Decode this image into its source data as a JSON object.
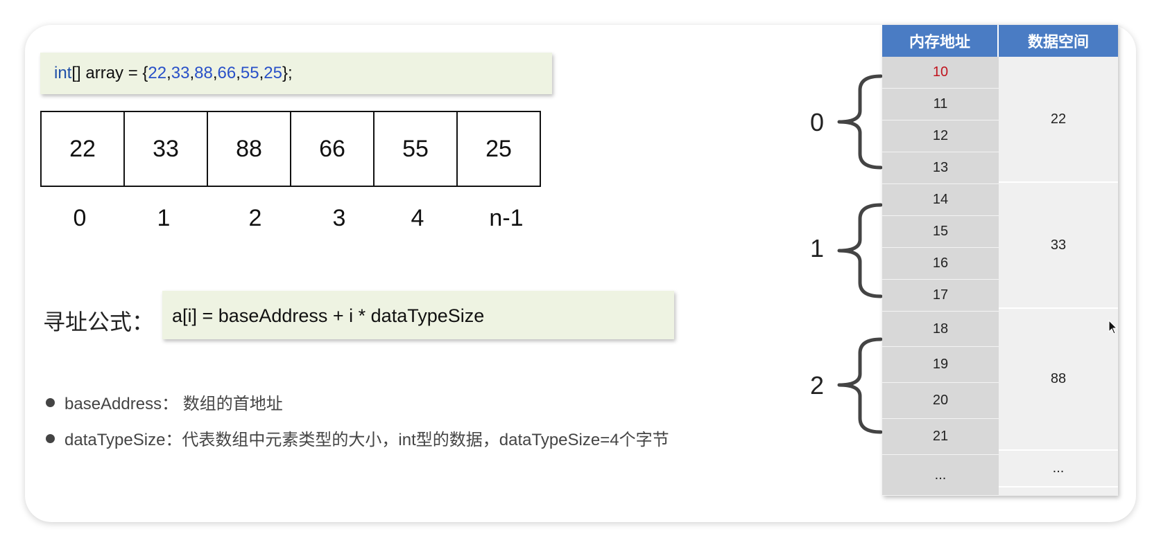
{
  "code": {
    "keyword": "int",
    "decl": "[] array = {",
    "values": [
      "22",
      "33",
      "88",
      "66",
      "55",
      "25"
    ],
    "end": "};"
  },
  "array_cells": [
    "22",
    "33",
    "88",
    "66",
    "55",
    "25"
  ],
  "array_indices": [
    "0",
    "1",
    "2",
    "3",
    "4",
    "n-1"
  ],
  "formula": {
    "label": "寻址公式：",
    "expression": "a[i] = baseAddress + i * dataTypeSize"
  },
  "notes": [
    "baseAddress： 数组的首地址",
    "dataTypeSize：代表数组中元素类型的大小，int型的数据，dataTypeSize=4个字节"
  ],
  "memory_table": {
    "header_address": "内存地址",
    "header_data": "数据空间",
    "addresses": [
      "10",
      "11",
      "12",
      "13",
      "14",
      "15",
      "16",
      "17",
      "18",
      "19",
      "20",
      "21",
      "..."
    ],
    "data": [
      "22",
      "33",
      "88",
      "..."
    ]
  },
  "brace_labels": [
    "0",
    "1",
    "2"
  ],
  "colors": {
    "header_blue": "#4a7cc4",
    "code_bg": "#eef3e2",
    "highlight_red": "#c0141e"
  }
}
